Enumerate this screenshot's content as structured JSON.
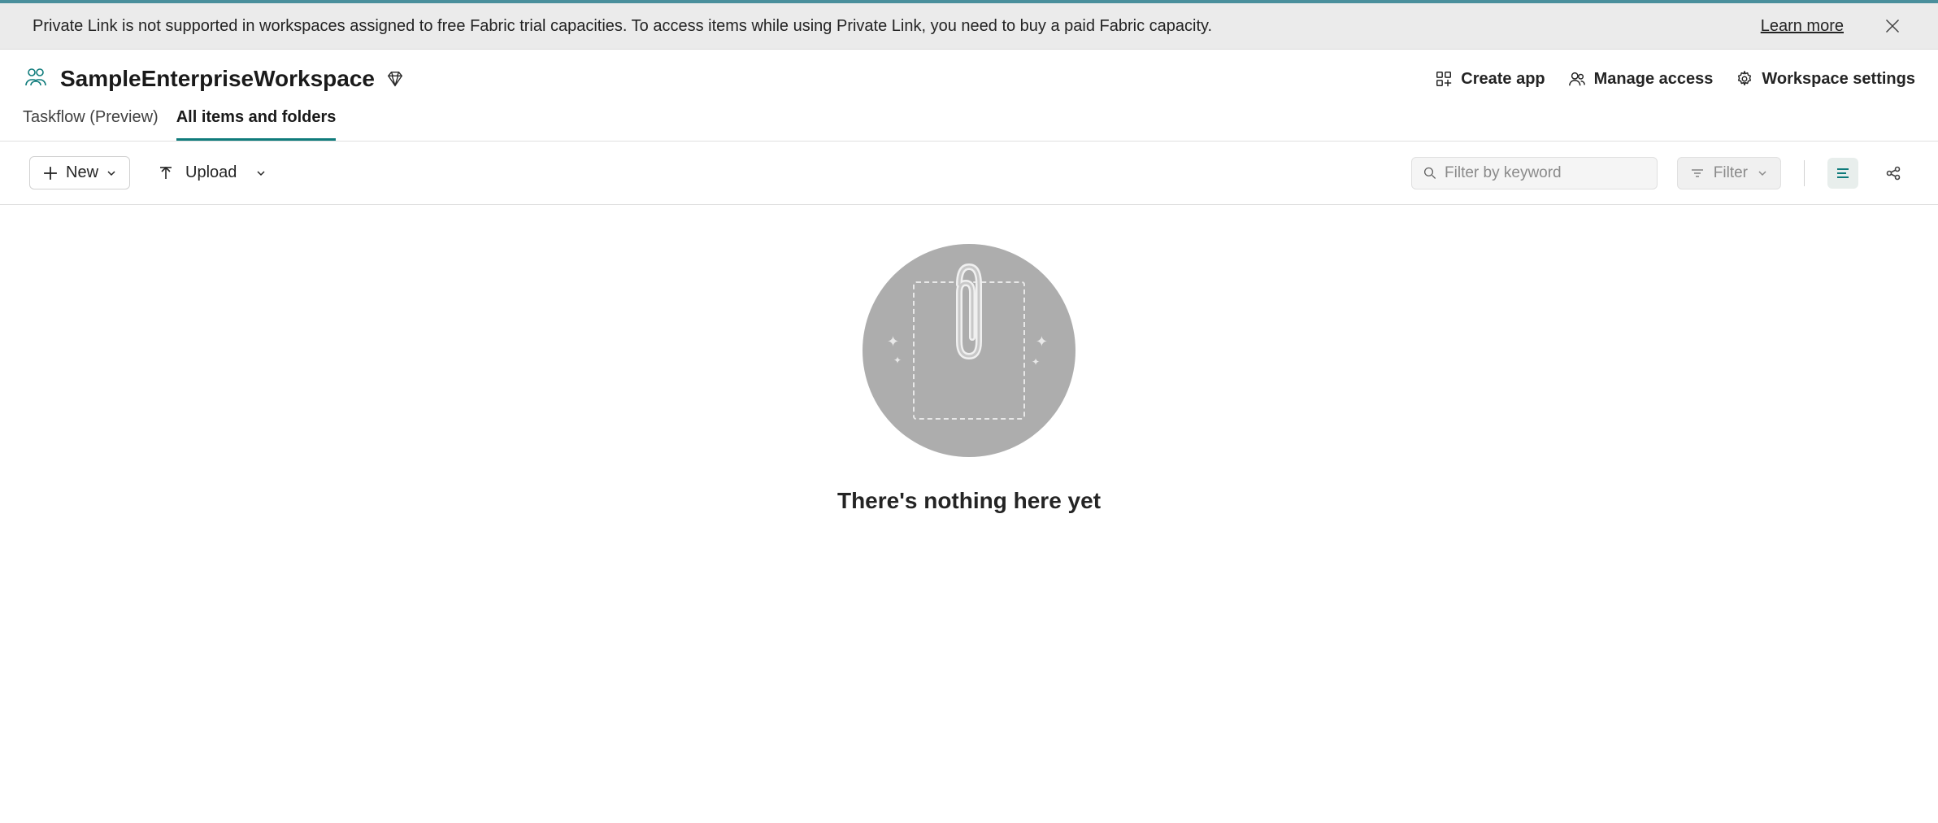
{
  "banner": {
    "message": "Private Link is not supported in workspaces assigned to free Fabric trial capacities. To access items while using Private Link, you need to buy a paid Fabric capacity.",
    "link_label": "Learn more"
  },
  "workspace": {
    "title": "SampleEnterpriseWorkspace"
  },
  "header_actions": {
    "create_app": "Create app",
    "manage_access": "Manage access",
    "workspace_settings": "Workspace settings"
  },
  "tabs": {
    "taskflow": "Taskflow (Preview)",
    "all_items": "All items and folders"
  },
  "toolbar": {
    "new_label": "New",
    "upload_label": "Upload",
    "filter_placeholder": "Filter by keyword",
    "filter_btn_label": "Filter"
  },
  "empty": {
    "title": "There's nothing here yet"
  }
}
